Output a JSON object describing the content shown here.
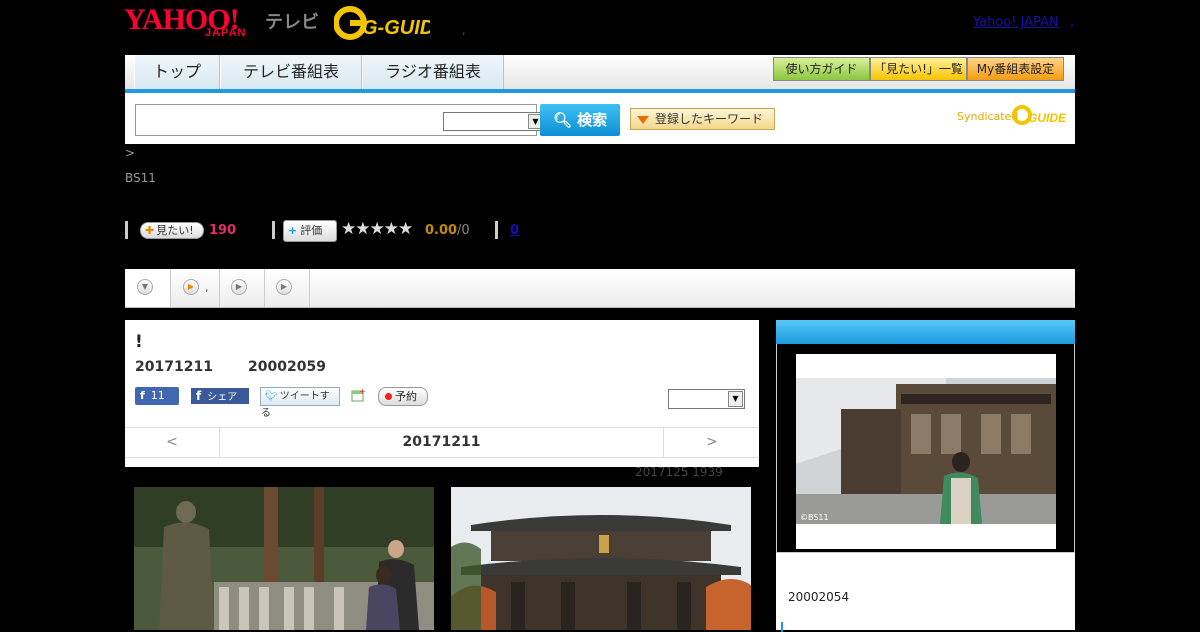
{
  "header": {
    "logo_yahoo": "YAHOO!",
    "logo_japan": "JAPAN",
    "logo_tv": "テレビ",
    "logo_gguide": "G-GUIDE",
    "dot": ",",
    "yahoo_japan_link": "Yahoo! JAPAN",
    "link_sep": ","
  },
  "nav": {
    "tabs": [
      "トップ",
      "テレビ番組表",
      "ラジオ番組表"
    ],
    "tools": [
      "使い方ガイド",
      "「見たい!」一覧",
      "My番組表設定"
    ]
  },
  "search": {
    "button": "検索",
    "keyword_button": "登録したキーワード",
    "syndicated": "Syndicated",
    "synd_logo": "GUIDE"
  },
  "breadcrumb": ">",
  "channel": "BS11",
  "stats": {
    "mitai_label": "見たい!",
    "mitai_count": "190",
    "hyoka_label": "評価",
    "stars": "★★★★★",
    "score": "0.00",
    "score_count": "/0",
    "zero_link": "0"
  },
  "tabs": {
    "tab2_text": ","
  },
  "program": {
    "title": "!",
    "date": "20171211",
    "id": "20002059",
    "fb_like_count": "11",
    "fb_share": "シェア",
    "tweet": "ツイートする",
    "reserve": "予約",
    "prev": "<",
    "current_date": "20171211",
    "next": ">",
    "updated": "2017125  1939"
  },
  "side": {
    "copyright": "©BS11",
    "id": "20002054"
  },
  "colors": {
    "accent": "#1e9be0",
    "mitai": "#e62a6b",
    "score": "#c98a00",
    "yahoo_red": "#ff0033"
  }
}
